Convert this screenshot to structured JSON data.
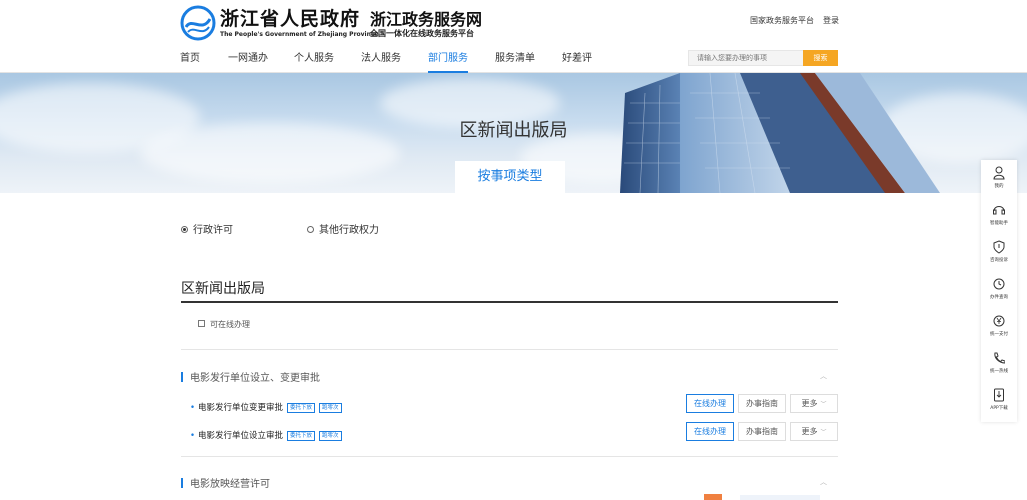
{
  "header": {
    "gov_title": "浙江省人民政府",
    "gov_title_en": "The People's Government of Zhejiang Province",
    "site_name": "浙江政务服务网",
    "site_subtitle": "全国一体化在线政务服务平台",
    "top_links": [
      "国家政务服务平台",
      "登录"
    ]
  },
  "nav": {
    "items": [
      {
        "label": "首页"
      },
      {
        "label": "一网通办"
      },
      {
        "label": "个人服务"
      },
      {
        "label": "法人服务"
      },
      {
        "label": "部门服务"
      },
      {
        "label": "服务清单"
      },
      {
        "label": "好差评"
      }
    ],
    "active_index": 4
  },
  "search": {
    "placeholder": "请输入您要办理的事项",
    "button_label": "搜索"
  },
  "banner": {
    "title": "区新闻出版局",
    "tab_label": "按事项类型"
  },
  "sidebar": {
    "items": [
      {
        "label": "我的",
        "icon": "user-icon"
      },
      {
        "label": "智能助手",
        "icon": "headset-icon"
      },
      {
        "label": "咨询投诉",
        "icon": "shield-icon"
      },
      {
        "label": "办件查询",
        "icon": "history-icon"
      },
      {
        "label": "统一支付",
        "icon": "yuan-icon"
      },
      {
        "label": "统一热线",
        "icon": "phone-icon"
      },
      {
        "label": "APP下载",
        "icon": "download-icon"
      }
    ]
  },
  "filters": {
    "options": [
      "行政许可",
      "其他行政权力"
    ],
    "selected_index": 0
  },
  "section": {
    "title": "区新闻出版局",
    "online_checkbox_label": "可在线办理"
  },
  "groups": [
    {
      "title": "电影发行单位设立、变更审批",
      "items": [
        {
          "name": "电影发行单位变更审批",
          "tags": [
            "委托下放",
            "跑零次"
          ]
        },
        {
          "name": "电影发行单位设立审批",
          "tags": [
            "委托下放",
            "跑零次"
          ]
        }
      ]
    },
    {
      "title": "电影放映经营许可",
      "items": []
    }
  ],
  "item_buttons": {
    "online": "在线办理",
    "guide": "办事指南",
    "more": "更多"
  },
  "colors": {
    "accent": "#1a7de0",
    "search_button": "#f5a623"
  }
}
